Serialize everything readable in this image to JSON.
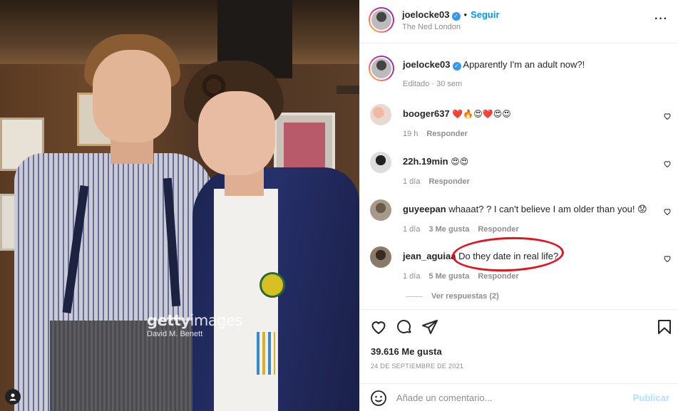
{
  "photo": {
    "watermark_brand": "getty",
    "watermark_brand_suffix": "images",
    "watermark_credit": "David M. Benett"
  },
  "header": {
    "username": "joelocke03",
    "separator": "•",
    "follow_label": "Seguir",
    "location": "The Ned London"
  },
  "caption": {
    "username": "joelocke03",
    "text": "Apparently I'm an adult now?!",
    "meta": "Editado · 30 sem"
  },
  "comments": [
    {
      "username": "booger637",
      "text": "❤️🔥😍❤️😍😍",
      "time": "19 h",
      "likes": "",
      "reply_label": "Responder"
    },
    {
      "username": "22h.19min",
      "text": "😍😍",
      "time": "1 día",
      "likes": "",
      "reply_label": "Responder"
    },
    {
      "username": "guyeepan",
      "text": "whaaat? ? I can't believe I am older than you! 😟",
      "time": "1 día",
      "likes": "3 Me gusta",
      "reply_label": "Responder"
    },
    {
      "username": "jean_aguiaa",
      "text": "Do they date in real life?",
      "time": "1 día",
      "likes": "5 Me gusta",
      "reply_label": "Responder"
    }
  ],
  "replies_label": "Ver respuestas (2)",
  "likes_count": "39.616 Me gusta",
  "post_date": "24 DE SEPTIEMBRE DE 2021",
  "add_comment": {
    "placeholder": "Añade un comentario...",
    "post_label": "Publicar"
  },
  "icons": {
    "verified": "verified-badge-icon",
    "more": "more-options-icon",
    "like": "heart-icon",
    "comment": "comment-icon",
    "share": "share-icon",
    "save": "bookmark-icon",
    "emoji": "emoji-icon"
  },
  "colors": {
    "link_blue": "#0095f6",
    "post_disabled": "#b2dffc",
    "annotation_red": "#e0141e"
  }
}
